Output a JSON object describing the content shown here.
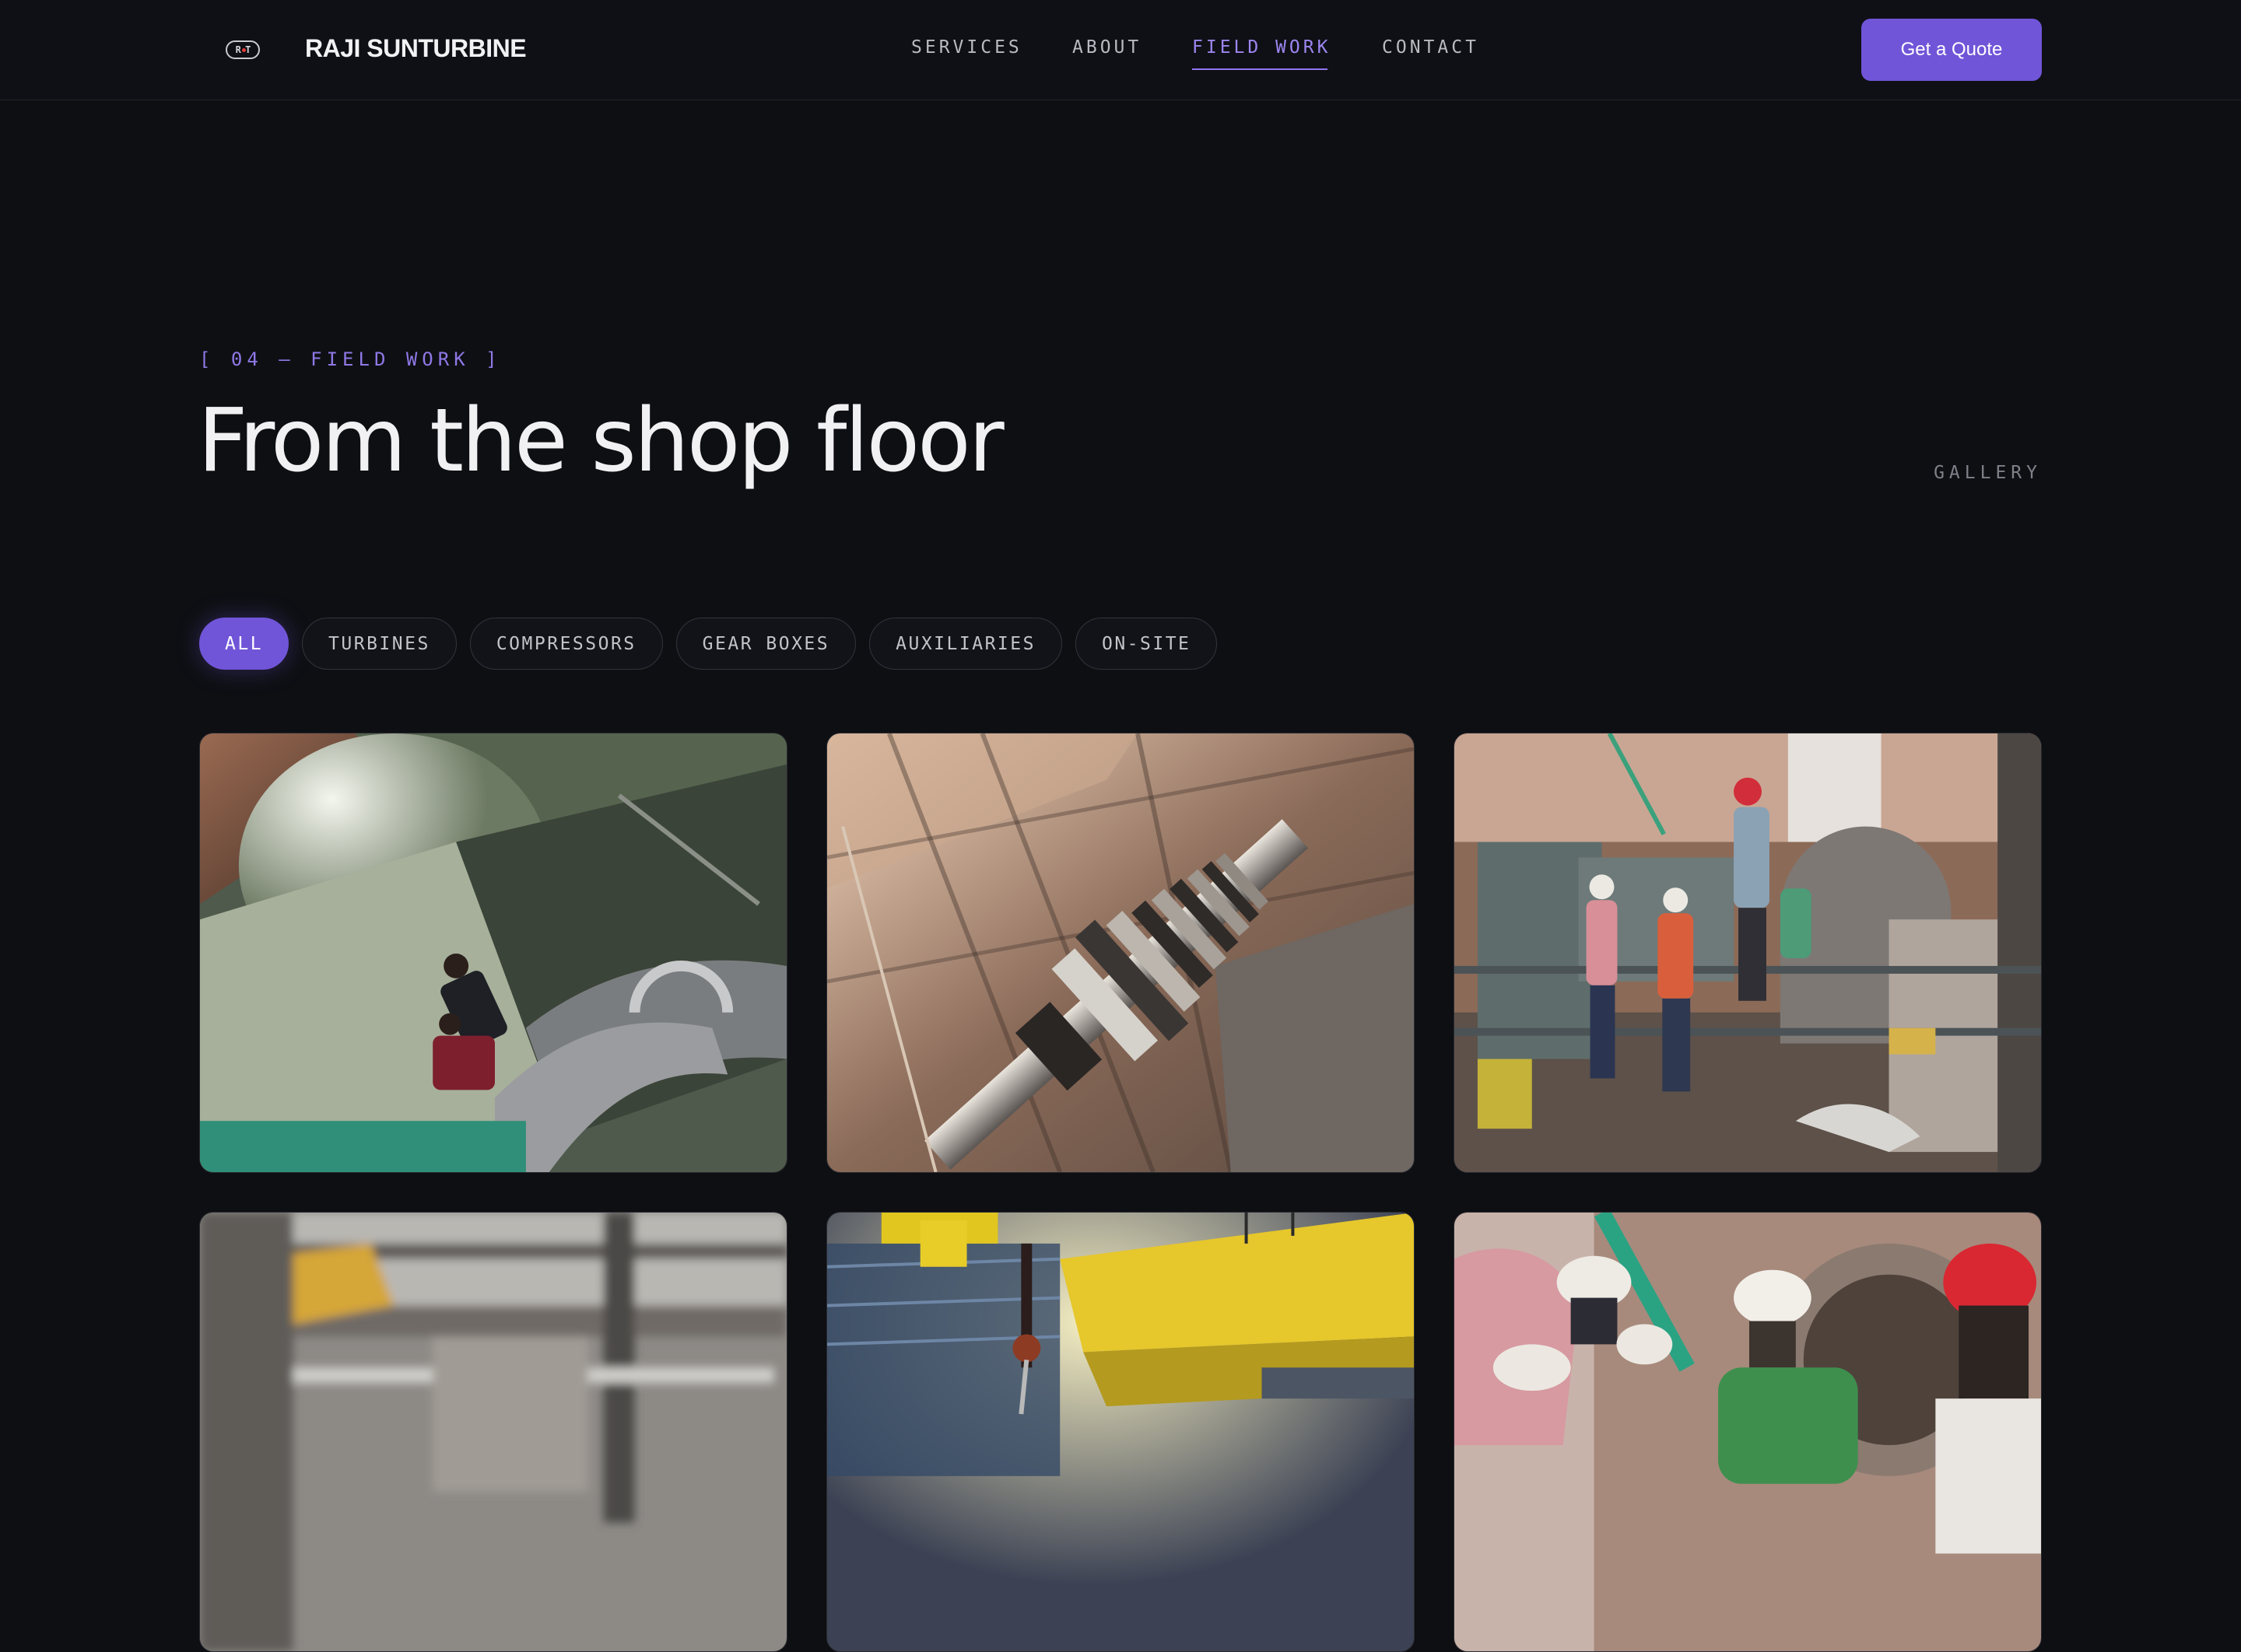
{
  "header": {
    "brand": "RAJI SUNTURBINE",
    "logo_mark": "R T",
    "nav": [
      {
        "label": "SERVICES",
        "active": false
      },
      {
        "label": "ABOUT",
        "active": false
      },
      {
        "label": "FIELD WORK",
        "active": true
      },
      {
        "label": "CONTACT",
        "active": false
      }
    ],
    "cta_label": "Get a Quote"
  },
  "section": {
    "eyebrow": "[ 04 — FIELD WORK ]",
    "title": "From the shop floor",
    "side_label": "GALLERY"
  },
  "filters": [
    {
      "label": "ALL",
      "active": true
    },
    {
      "label": "TURBINES",
      "active": false
    },
    {
      "label": "COMPRESSORS",
      "active": false
    },
    {
      "label": "GEAR BOXES",
      "active": false
    },
    {
      "label": "AUXILIARIES",
      "active": false
    },
    {
      "label": "ON-SITE",
      "active": false
    }
  ],
  "gallery": {
    "items": [
      {
        "subject": "technicians-inspecting-turbine-casing"
      },
      {
        "subject": "turbine-rotor-on-crane"
      },
      {
        "subject": "crew-at-compressor-site"
      },
      {
        "subject": "blurred-shop-floor-crane"
      },
      {
        "subject": "yellow-overhead-crane"
      },
      {
        "subject": "workers-in-hard-hats"
      }
    ]
  },
  "colors": {
    "background": "#0e0f13",
    "accent": "#7055d8",
    "accent_text": "#9d86f0"
  }
}
